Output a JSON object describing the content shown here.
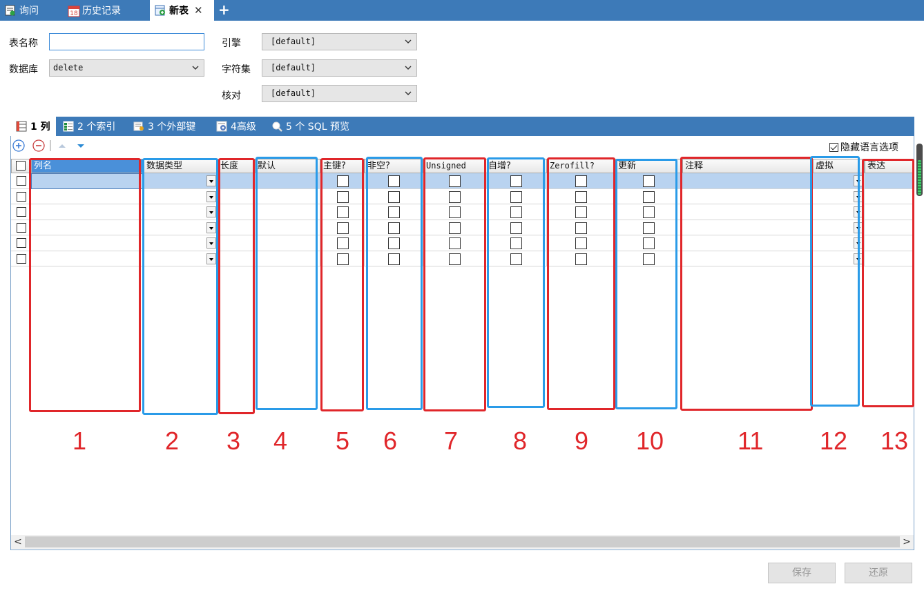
{
  "tabs": [
    {
      "label": "询问",
      "icon": "query-icon"
    },
    {
      "label": "历史记录",
      "icon": "calendar-icon",
      "icon_text": "18"
    },
    {
      "label": "新表",
      "icon": "new-table-icon",
      "active": true
    }
  ],
  "form": {
    "table_name_label": "表名称",
    "table_name_value": "",
    "database_label": "数据库",
    "database_value": "delete",
    "engine_label": "引擎",
    "engine_value": "[default]",
    "charset_label": "字符集",
    "charset_value": "[default]",
    "collation_label": "核对",
    "collation_value": "[default]"
  },
  "subtabs": [
    {
      "label": "1 列",
      "icon": "columns-icon",
      "active": true
    },
    {
      "label": "2 个索引",
      "icon": "index-icon"
    },
    {
      "label": "3 个外部键",
      "icon": "foreign-key-icon"
    },
    {
      "label": "4高级",
      "icon": "advanced-icon"
    },
    {
      "label": "5 个 SQL 预览",
      "icon": "sql-preview-icon"
    }
  ],
  "toolbar": {
    "hide_language_label": "隐藏语言选项",
    "hide_language_checked": true
  },
  "columns": [
    "列名",
    "数据类型",
    "长度",
    "默认",
    "主键?",
    "非空?",
    "Unsigned",
    "自增?",
    "Zerofill?",
    "更新",
    "注释",
    "虚拟",
    "表达"
  ],
  "row_count": 6,
  "annotations": [
    "1",
    "2",
    "3",
    "4",
    "5",
    "6",
    "7",
    "8",
    "9",
    "10",
    "11",
    "12",
    "13"
  ],
  "buttons": {
    "save": "保存",
    "revert": "还原"
  },
  "colors": {
    "accent": "#3d7ab8",
    "annotation_red": "#e0262a",
    "annotation_blue": "#2a9be8"
  }
}
